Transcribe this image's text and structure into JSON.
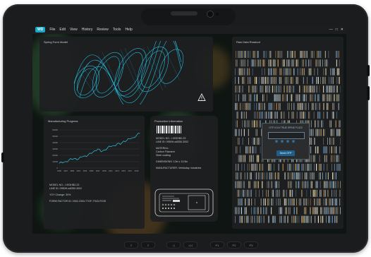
{
  "app": {
    "logo": "WD"
  },
  "menu": [
    "File",
    "Edit",
    "View",
    "History",
    "Review",
    "Tools",
    "Help"
  ],
  "window_controls": [
    "—",
    "□",
    "✕"
  ],
  "spring_panel": {
    "title": "Spring Form Model"
  },
  "manufacturing": {
    "title": "Manufacturing Progress",
    "model_no": "MODEL NO.: I-903HB2-23",
    "line_id": "LINE ID: 0950H-w8350-3002",
    "yoy": "YOY Change: 30%",
    "form_factor": "FORM FACTOR ID: 2302-2304-T7GF-TS43-FD35"
  },
  "chart_data": {
    "type": "line",
    "x": [
      1995,
      1996,
      1997,
      1998,
      1999,
      2000,
      2001,
      2002,
      2003,
      2004,
      2005,
      2006,
      2007,
      2008,
      2009,
      2010,
      2011,
      2012,
      2013,
      2014,
      2015,
      2016,
      2017,
      2018,
      2019,
      2020
    ],
    "values": [
      14,
      15,
      19,
      23,
      25,
      28,
      26,
      32,
      35,
      38,
      42,
      50,
      55,
      47,
      52,
      58,
      62,
      65,
      70,
      68,
      78,
      80,
      84,
      88,
      94,
      100
    ],
    "yticks": [
      "60000",
      "50000",
      "40000",
      "30000",
      "20000",
      "10000",
      "0"
    ],
    "ylim": [
      0,
      110
    ],
    "grid": true
  },
  "production": {
    "title": "Production Information",
    "model_no": "MODEL NO.: I-903HB2-23",
    "line_id": "LINE ID: 0950H-w8350-3002",
    "material_label": "MATERIAL:",
    "material_1": "Carbon Filament",
    "material_2": "Steel coating",
    "dimensions": "DIMENSIONS: 12in x 13.5in",
    "manufacturer": "MANUFACTURER: Veridsday Industries"
  },
  "raw_data": {
    "title": "Raw Data Readout"
  },
  "otp": {
    "title": "OTP IS IN TRUE SPINE F1423",
    "code": "****",
    "button": "Send OTP"
  },
  "hardware_buttons": [
    "≡",
    "≡",
    "◁",
    "◁◁",
    "P1",
    "P2",
    "P3"
  ],
  "colors": {
    "accent": "#1aa6c9",
    "wire": "#28c3e4",
    "otp": "#3aa0e0"
  }
}
